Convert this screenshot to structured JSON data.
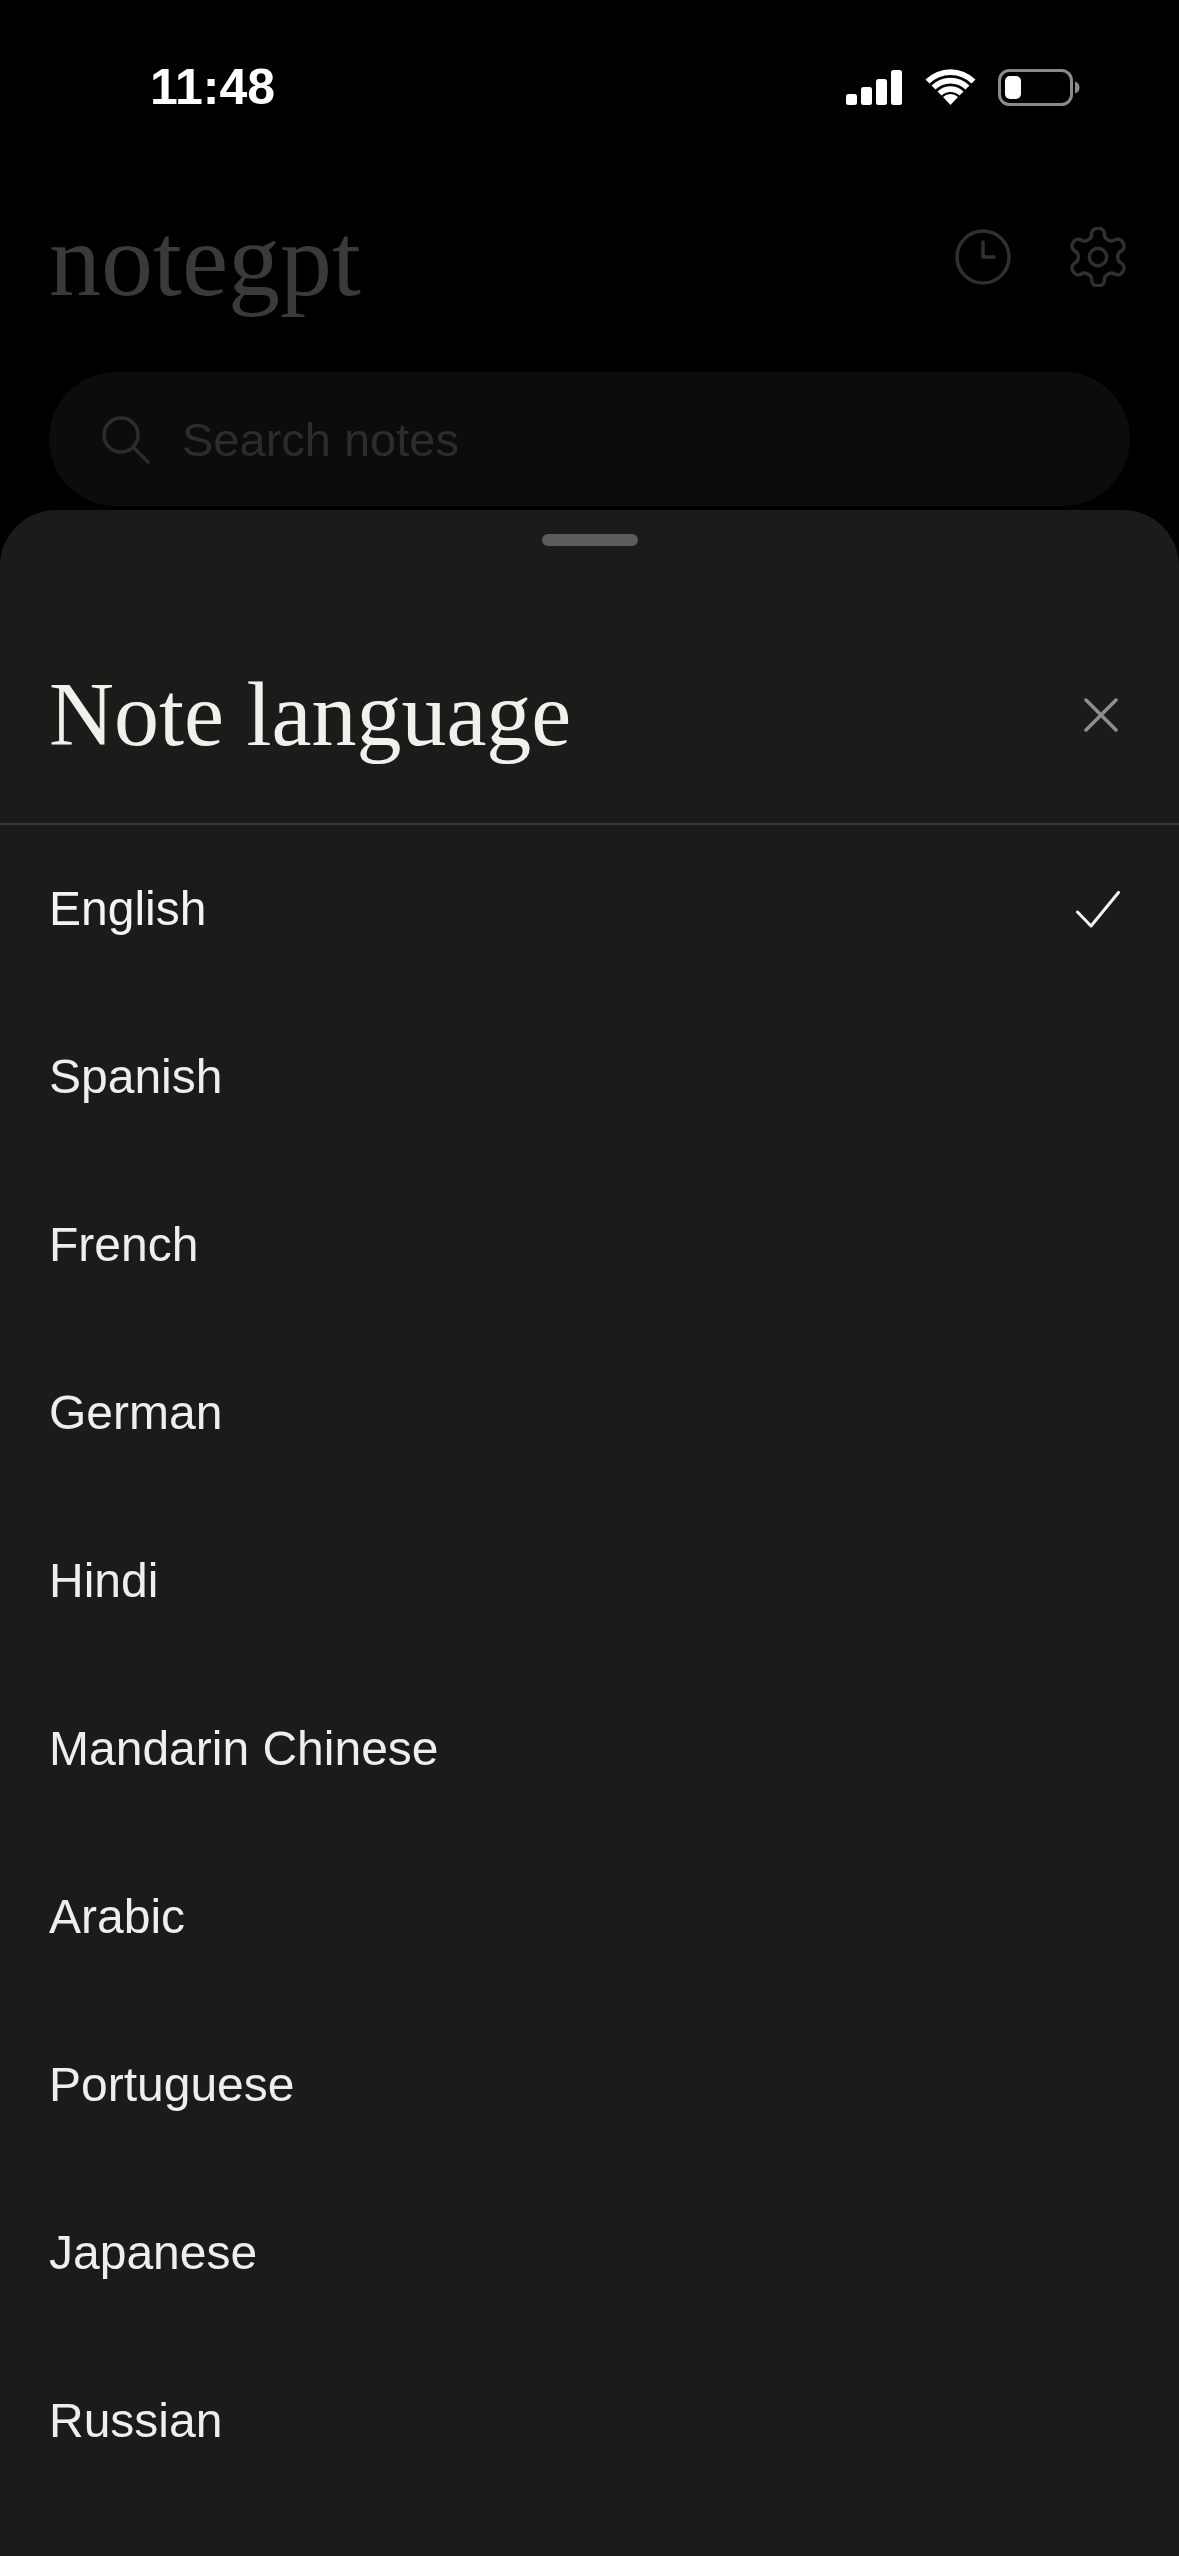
{
  "status_bar": {
    "time": "11:48"
  },
  "header": {
    "title": "notegpt"
  },
  "search": {
    "placeholder": "Search notes"
  },
  "sheet": {
    "title": "Note language",
    "options": [
      {
        "label": "English",
        "selected": true
      },
      {
        "label": "Spanish",
        "selected": false
      },
      {
        "label": "French",
        "selected": false
      },
      {
        "label": "German",
        "selected": false
      },
      {
        "label": "Hindi",
        "selected": false
      },
      {
        "label": "Mandarin Chinese",
        "selected": false
      },
      {
        "label": "Arabic",
        "selected": false
      },
      {
        "label": "Portuguese",
        "selected": false
      },
      {
        "label": "Japanese",
        "selected": false
      },
      {
        "label": "Russian",
        "selected": false
      }
    ]
  }
}
